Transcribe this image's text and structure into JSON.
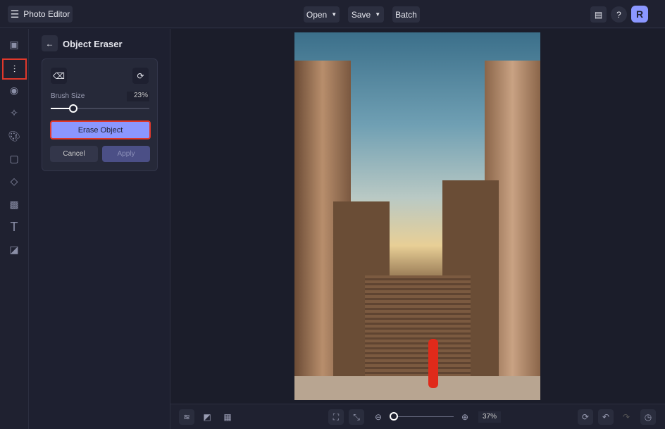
{
  "app": {
    "title": "Photo Editor",
    "avatar_initial": "R"
  },
  "topbar": {
    "open_label": "Open",
    "save_label": "Save",
    "batch_label": "Batch"
  },
  "panel": {
    "title": "Object Eraser",
    "brush_size_label": "Brush Size",
    "brush_size_value": "23%",
    "brush_size_fraction": 0.23,
    "erase_label": "Erase Object",
    "cancel_label": "Cancel",
    "apply_label": "Apply"
  },
  "bottombar": {
    "zoom_value": "37%",
    "zoom_fraction": 0.05
  },
  "colors": {
    "accent": "#8b97ff",
    "highlight": "#e0382b"
  }
}
